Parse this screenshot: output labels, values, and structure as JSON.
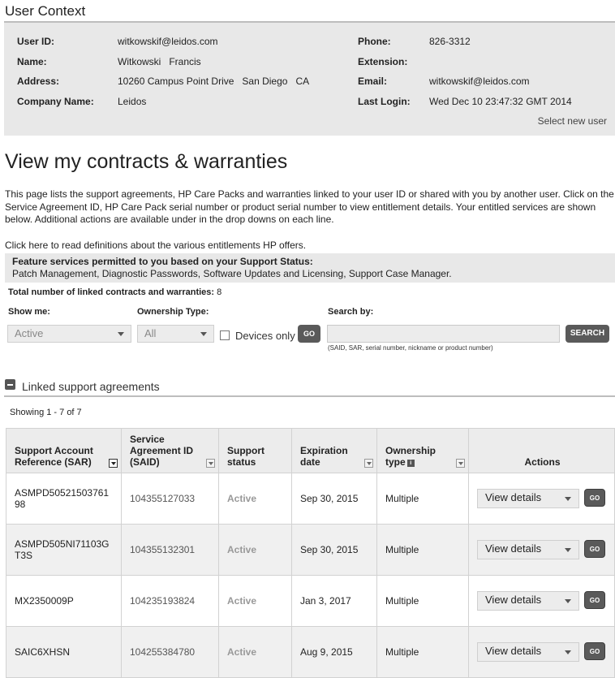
{
  "user_context": {
    "title": "User Context",
    "fields_left": [
      {
        "label": "User ID:",
        "value": "witkowskif@leidos.com"
      },
      {
        "label": "Name:",
        "value": "Witkowski   Francis"
      },
      {
        "label": "Address:",
        "value": "10260 Campus Point Drive   San Diego   CA"
      },
      {
        "label": "Company Name:",
        "value": "Leidos"
      }
    ],
    "fields_right": [
      {
        "label": "Phone:",
        "value": "826-3312"
      },
      {
        "label": "Extension:",
        "value": ""
      },
      {
        "label": "Email:",
        "value": "witkowskif@leidos.com"
      },
      {
        "label": "Last Login:",
        "value": "Wed Dec 10 23:47:32 GMT 2014"
      }
    ],
    "select_new_user": "Select new user"
  },
  "page": {
    "title": "View my contracts & warranties",
    "intro": "This page lists the support agreements, HP Care Packs and warranties linked to your user ID or shared with you by another user. Click on the Service Agreement ID, HP Care Pack serial number or product serial number to view entitlement details. Your entitled services are shown below. Additional actions are available under in the drop downs on each line.",
    "click_here": "Click here",
    "click_here_rest": " to read definitions about the various entitlements HP offers."
  },
  "features": {
    "title": "Feature services permitted to you based on your Support Status:",
    "list": "Patch Management, Diagnostic Passwords, Software Updates and Licensing, Support Case Manager."
  },
  "totals": {
    "label": "Total number of linked contracts and warranties:",
    "count": "8"
  },
  "filters": {
    "show_me_label": "Show me:",
    "show_me_value": "Active",
    "ownership_label": "Ownership Type:",
    "ownership_value": "All",
    "devices_only": "Devices only",
    "go": "GO",
    "search_label": "Search by:",
    "search_value": "",
    "search_button": "SEARCH",
    "search_hint": "(SAID, SAR, serial number, nickname or product number)"
  },
  "linked": {
    "title": "Linked support agreements",
    "showing": "Showing 1 - 7 of 7"
  },
  "table": {
    "headers": {
      "sar_line1": "Support Account",
      "sar_line2": "Reference (SAR)",
      "said_line1": "Service",
      "said_line2": "Agreement ID",
      "said_line3": "(SAID)",
      "status_line1": "Support",
      "status_line2": "status",
      "exp_line1": "Expiration",
      "exp_line2": "date",
      "own_line1": "Ownership",
      "own_line2": "type",
      "actions": "Actions"
    },
    "rows": [
      {
        "sar": "ASMPD50521503761 98",
        "said": "104355127033",
        "status": "Active",
        "expiration": "Sep 30, 2015",
        "ownership": "Multiple",
        "action": "View details",
        "go": "GO"
      },
      {
        "sar": "ASMPD505NI71103G T3S",
        "said": "104355132301",
        "status": "Active",
        "expiration": "Sep 30, 2015",
        "ownership": "Multiple",
        "action": "View details",
        "go": "GO"
      },
      {
        "sar": "MX2350009P",
        "said": "104235193824",
        "status": "Active",
        "expiration": "Jan 3, 2017",
        "ownership": "Multiple",
        "action": "View details",
        "go": "GO"
      },
      {
        "sar": "SAIC6XHSN",
        "said": "104255384780",
        "status": "Active",
        "expiration": "Aug 9, 2015",
        "ownership": "Multiple",
        "action": "View details",
        "go": "GO"
      }
    ]
  }
}
